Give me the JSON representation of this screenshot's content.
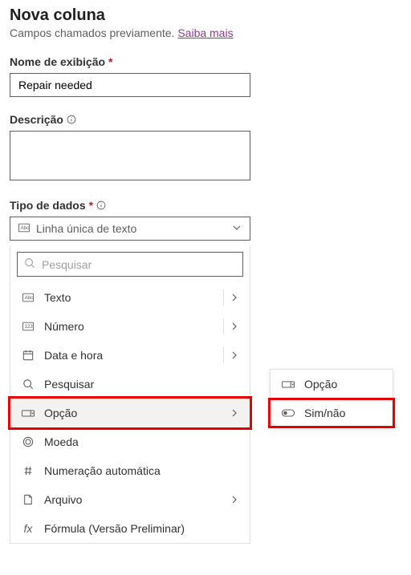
{
  "header": {
    "title": "Nova coluna",
    "subtitle_prefix": "Campos chamados previamente. ",
    "subtitle_link": "Saiba mais"
  },
  "fields": {
    "display_name": {
      "label": "Nome de exibição",
      "value": "Repair needed"
    },
    "description": {
      "label": "Descrição",
      "value": ""
    },
    "data_type": {
      "label": "Tipo de dados",
      "selected": "Linha única de texto",
      "search_placeholder": "Pesquisar",
      "options": [
        {
          "label": "Texto",
          "has_submenu": true
        },
        {
          "label": "Número",
          "has_submenu": true
        },
        {
          "label": "Data e hora",
          "has_submenu": true
        },
        {
          "label": "Pesquisar",
          "has_submenu": false
        },
        {
          "label": "Opção",
          "has_submenu": true,
          "highlighted": true
        },
        {
          "label": "Moeda",
          "has_submenu": false
        },
        {
          "label": "Numeração automática",
          "has_submenu": false
        },
        {
          "label": "Arquivo",
          "has_submenu": true
        },
        {
          "label": "Fórmula (Versão Preliminar)",
          "has_submenu": false
        }
      ],
      "submenu": [
        {
          "label": "Opção"
        },
        {
          "label": "Sim/não",
          "highlighted": true
        }
      ]
    }
  }
}
